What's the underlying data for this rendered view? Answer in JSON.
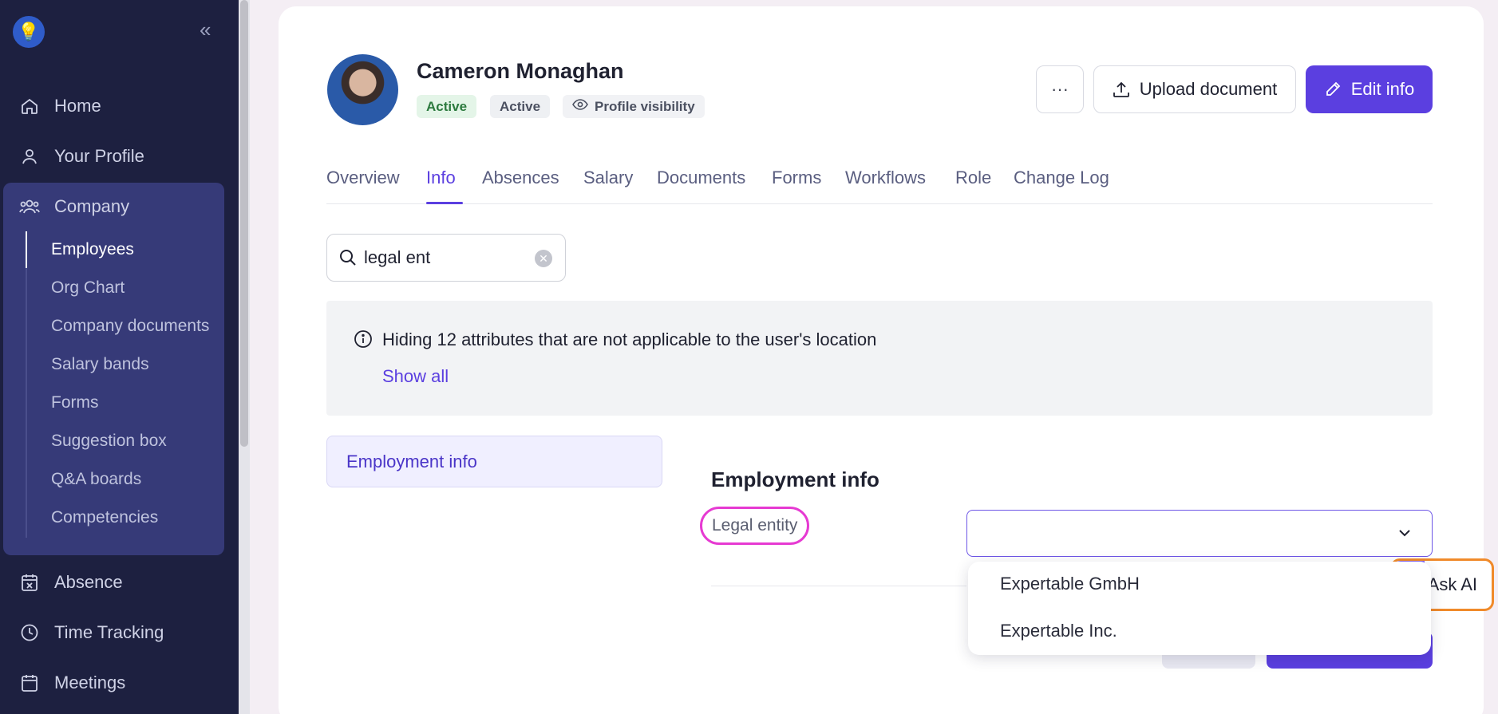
{
  "sidebar": {
    "items": [
      {
        "label": "Home",
        "icon": "home-icon"
      },
      {
        "label": "Your Profile",
        "icon": "user-icon"
      },
      {
        "label": "Company",
        "icon": "people-icon"
      },
      {
        "label": "Absence",
        "icon": "calendar-x-icon"
      },
      {
        "label": "Time Tracking",
        "icon": "clock-icon"
      },
      {
        "label": "Meetings",
        "icon": "calendar-icon"
      }
    ],
    "company_sub": [
      "Employees",
      "Org Chart",
      "Company documents",
      "Salary bands",
      "Forms",
      "Suggestion box",
      "Q&A boards",
      "Competencies"
    ]
  },
  "profile": {
    "name": "Cameron Monaghan",
    "badges": [
      "Active",
      "Active",
      "Profile visibility"
    ]
  },
  "header_buttons": {
    "more": "···",
    "upload": "Upload document",
    "edit": "Edit info"
  },
  "tabs": [
    "Overview",
    "Info",
    "Absences",
    "Salary",
    "Documents",
    "Forms",
    "Workflows",
    "Role",
    "Change Log"
  ],
  "search": {
    "value": "legal ent"
  },
  "notice": {
    "text": "Hiding 12 attributes that are not applicable to the user's location",
    "link": "Show all"
  },
  "section_nav": {
    "label": "Employment info"
  },
  "section": {
    "title": "Employment info",
    "field_label": "Legal entity",
    "options": [
      "Expertable GmbH",
      "Expertable Inc."
    ]
  },
  "ask_ai": {
    "label": "Ask AI"
  },
  "colors": {
    "accent": "#5b3fe0",
    "sidebar": "#1d2040",
    "highlight": "#e63ad2",
    "ask_ai_border": "#f08a2a"
  }
}
